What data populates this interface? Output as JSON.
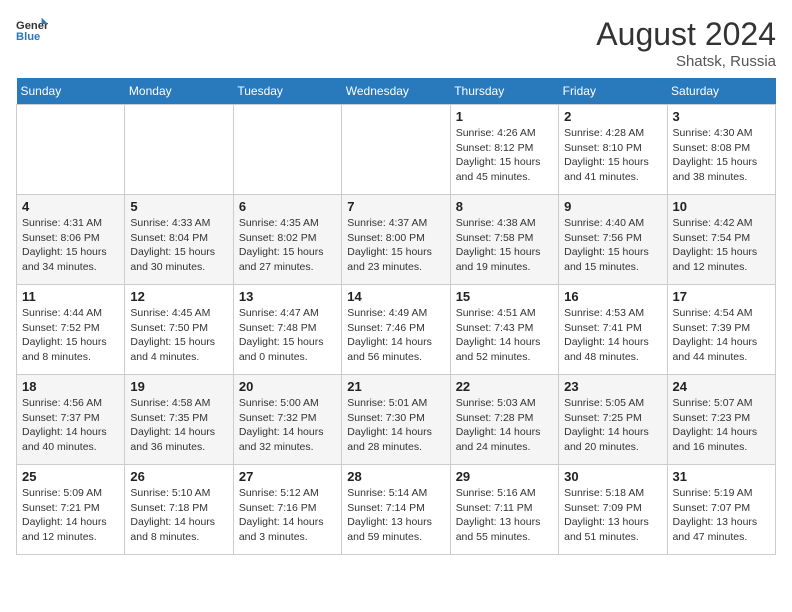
{
  "header": {
    "logo_line1": "General",
    "logo_line2": "Blue",
    "month_year": "August 2024",
    "location": "Shatsk, Russia"
  },
  "weekdays": [
    "Sunday",
    "Monday",
    "Tuesday",
    "Wednesday",
    "Thursday",
    "Friday",
    "Saturday"
  ],
  "weeks": [
    [
      {
        "day": "",
        "info": ""
      },
      {
        "day": "",
        "info": ""
      },
      {
        "day": "",
        "info": ""
      },
      {
        "day": "",
        "info": ""
      },
      {
        "day": "1",
        "info": "Sunrise: 4:26 AM\nSunset: 8:12 PM\nDaylight: 15 hours\nand 45 minutes."
      },
      {
        "day": "2",
        "info": "Sunrise: 4:28 AM\nSunset: 8:10 PM\nDaylight: 15 hours\nand 41 minutes."
      },
      {
        "day": "3",
        "info": "Sunrise: 4:30 AM\nSunset: 8:08 PM\nDaylight: 15 hours\nand 38 minutes."
      }
    ],
    [
      {
        "day": "4",
        "info": "Sunrise: 4:31 AM\nSunset: 8:06 PM\nDaylight: 15 hours\nand 34 minutes."
      },
      {
        "day": "5",
        "info": "Sunrise: 4:33 AM\nSunset: 8:04 PM\nDaylight: 15 hours\nand 30 minutes."
      },
      {
        "day": "6",
        "info": "Sunrise: 4:35 AM\nSunset: 8:02 PM\nDaylight: 15 hours\nand 27 minutes."
      },
      {
        "day": "7",
        "info": "Sunrise: 4:37 AM\nSunset: 8:00 PM\nDaylight: 15 hours\nand 23 minutes."
      },
      {
        "day": "8",
        "info": "Sunrise: 4:38 AM\nSunset: 7:58 PM\nDaylight: 15 hours\nand 19 minutes."
      },
      {
        "day": "9",
        "info": "Sunrise: 4:40 AM\nSunset: 7:56 PM\nDaylight: 15 hours\nand 15 minutes."
      },
      {
        "day": "10",
        "info": "Sunrise: 4:42 AM\nSunset: 7:54 PM\nDaylight: 15 hours\nand 12 minutes."
      }
    ],
    [
      {
        "day": "11",
        "info": "Sunrise: 4:44 AM\nSunset: 7:52 PM\nDaylight: 15 hours\nand 8 minutes."
      },
      {
        "day": "12",
        "info": "Sunrise: 4:45 AM\nSunset: 7:50 PM\nDaylight: 15 hours\nand 4 minutes."
      },
      {
        "day": "13",
        "info": "Sunrise: 4:47 AM\nSunset: 7:48 PM\nDaylight: 15 hours\nand 0 minutes."
      },
      {
        "day": "14",
        "info": "Sunrise: 4:49 AM\nSunset: 7:46 PM\nDaylight: 14 hours\nand 56 minutes."
      },
      {
        "day": "15",
        "info": "Sunrise: 4:51 AM\nSunset: 7:43 PM\nDaylight: 14 hours\nand 52 minutes."
      },
      {
        "day": "16",
        "info": "Sunrise: 4:53 AM\nSunset: 7:41 PM\nDaylight: 14 hours\nand 48 minutes."
      },
      {
        "day": "17",
        "info": "Sunrise: 4:54 AM\nSunset: 7:39 PM\nDaylight: 14 hours\nand 44 minutes."
      }
    ],
    [
      {
        "day": "18",
        "info": "Sunrise: 4:56 AM\nSunset: 7:37 PM\nDaylight: 14 hours\nand 40 minutes."
      },
      {
        "day": "19",
        "info": "Sunrise: 4:58 AM\nSunset: 7:35 PM\nDaylight: 14 hours\nand 36 minutes."
      },
      {
        "day": "20",
        "info": "Sunrise: 5:00 AM\nSunset: 7:32 PM\nDaylight: 14 hours\nand 32 minutes."
      },
      {
        "day": "21",
        "info": "Sunrise: 5:01 AM\nSunset: 7:30 PM\nDaylight: 14 hours\nand 28 minutes."
      },
      {
        "day": "22",
        "info": "Sunrise: 5:03 AM\nSunset: 7:28 PM\nDaylight: 14 hours\nand 24 minutes."
      },
      {
        "day": "23",
        "info": "Sunrise: 5:05 AM\nSunset: 7:25 PM\nDaylight: 14 hours\nand 20 minutes."
      },
      {
        "day": "24",
        "info": "Sunrise: 5:07 AM\nSunset: 7:23 PM\nDaylight: 14 hours\nand 16 minutes."
      }
    ],
    [
      {
        "day": "25",
        "info": "Sunrise: 5:09 AM\nSunset: 7:21 PM\nDaylight: 14 hours\nand 12 minutes."
      },
      {
        "day": "26",
        "info": "Sunrise: 5:10 AM\nSunset: 7:18 PM\nDaylight: 14 hours\nand 8 minutes."
      },
      {
        "day": "27",
        "info": "Sunrise: 5:12 AM\nSunset: 7:16 PM\nDaylight: 14 hours\nand 3 minutes."
      },
      {
        "day": "28",
        "info": "Sunrise: 5:14 AM\nSunset: 7:14 PM\nDaylight: 13 hours\nand 59 minutes."
      },
      {
        "day": "29",
        "info": "Sunrise: 5:16 AM\nSunset: 7:11 PM\nDaylight: 13 hours\nand 55 minutes."
      },
      {
        "day": "30",
        "info": "Sunrise: 5:18 AM\nSunset: 7:09 PM\nDaylight: 13 hours\nand 51 minutes."
      },
      {
        "day": "31",
        "info": "Sunrise: 5:19 AM\nSunset: 7:07 PM\nDaylight: 13 hours\nand 47 minutes."
      }
    ]
  ]
}
